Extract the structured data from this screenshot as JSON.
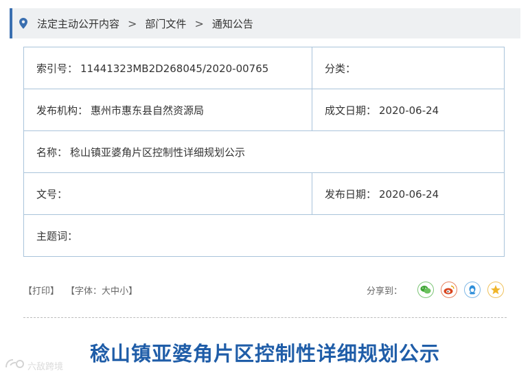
{
  "breadcrumb": {
    "items": [
      "法定主动公开内容",
      "部门文件",
      "通知公告"
    ],
    "separator": ">"
  },
  "info": {
    "index_label": "索引号：",
    "index_value": "11441323MB2D268045/2020-00765",
    "category_label": "分类：",
    "category_value": "",
    "publisher_label": "发布机构：",
    "publisher_value": "惠州市惠东县自然资源局",
    "created_label": "成文日期：",
    "created_value": "2020-06-24",
    "name_label": "名称：",
    "name_value": "稔山镇亚婆角片区控制性详细规划公示",
    "docno_label": "文号：",
    "docno_value": "",
    "published_label": "发布日期：",
    "published_value": "2020-06-24",
    "subject_label": "主题词：",
    "subject_value": ""
  },
  "toolbar": {
    "print": "【打印】",
    "font_prefix": "【字体：",
    "size_large": "大",
    "size_medium": "中",
    "size_small": "小",
    "font_suffix": "】",
    "share_label": "分享到：",
    "share_icons": [
      "wechat-icon",
      "weibo-icon",
      "qq-icon",
      "qzone-icon"
    ]
  },
  "article": {
    "title": "稔山镇亚婆角片区控制性详细规划公示"
  },
  "watermark": {
    "text": "六敌跨境"
  },
  "colors": {
    "accent": "#3a6fb0",
    "title": "#1f5da8",
    "table_border": "#a9c3da",
    "breadcrumb_bg": "#eef0f2"
  }
}
